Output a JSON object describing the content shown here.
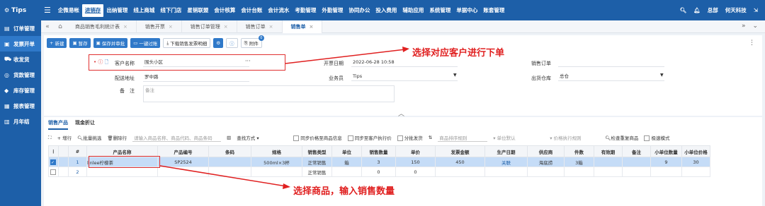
{
  "topbar": {
    "logo": "Tips",
    "nav": [
      "企微易帐",
      "进销存",
      "出纳管理",
      "线上商城",
      "线下门店",
      "星销联盟",
      "会计核算",
      "会计台账",
      "会计流水",
      "考勤管理",
      "外勤管理",
      "协同办公",
      "投入费用",
      "辅助应用",
      "系统管理",
      "单据中心",
      "账套管理"
    ],
    "active_nav": "进销存",
    "user": "总部",
    "company": "何天科技"
  },
  "sidebar": [
    {
      "label": "订单管理",
      "icon": "clipboard-icon"
    },
    {
      "label": "发票开单",
      "icon": "invoice-icon"
    },
    {
      "label": "收发货",
      "icon": "truck-icon"
    },
    {
      "label": "货款管理",
      "icon": "money-icon"
    },
    {
      "label": "库存管理",
      "icon": "warehouse-icon"
    },
    {
      "label": "报表管理",
      "icon": "report-icon"
    },
    {
      "label": "月年结",
      "icon": "calendar-icon"
    }
  ],
  "tabs": [
    "商品销售毛利统计表",
    "销售开票",
    "销售订单管理",
    "销售订单",
    "销售单"
  ],
  "toolbar": {
    "new": "新建",
    "save": "暂存",
    "save_audit": "保存并审批",
    "one_click": "一键过账",
    "download": "下载销售发票明细",
    "attachment": "附件",
    "attachment_count": "0"
  },
  "form": {
    "customer_label": "客户名称",
    "customer_value": "围头小区",
    "address_label": "配送地址",
    "address_value": "罗中路",
    "remark_label": "备　注",
    "remark_placeholder": "备注",
    "date_label": "开票日期",
    "date_value": "2022-06-28 10:58",
    "salesman_label": "业务员",
    "salesman_value": "Tips",
    "order_label": "销售订单",
    "order_value": "",
    "warehouse_label": "出货仓库",
    "warehouse_value": "总仓"
  },
  "grid": {
    "subtabs": [
      "销售产品",
      "现金折让"
    ],
    "tools": {
      "add_row": "增行",
      "batch_select": "批量挑选",
      "delete_row": "删除行",
      "search_placeholder": "请输入商品名称、商品代码、商品条码",
      "find_mode": "查找方式",
      "sync_price": "同步价格至商品信息",
      "sync_customer": "同步至客户执行价",
      "batch_ship": "分批发货",
      "sort_placeholder": "商品排序规则",
      "unit_default": "单位默认",
      "price_rule": "价格执行规则",
      "check_dup": "检查重复商品",
      "fast_mode": "极速模式"
    },
    "columns": [
      "#",
      "产品名称",
      "产品编号",
      "条码",
      "规格",
      "销售类型",
      "单位",
      "销售数量",
      "单价",
      "发票金额",
      "生产日期",
      "供应商",
      "件数",
      "有效期",
      "备注",
      "小单位数量",
      "小单位价格"
    ],
    "rows": [
      {
        "no": "1",
        "name": "linlee柠檬茶",
        "code": "SP2524",
        "barcode": "",
        "spec": "500ml×3杯",
        "type": "正常销售",
        "unit": "箱",
        "qty": "3",
        "price": "150",
        "amount": "450",
        "date": "关联",
        "supplier": "海底捞",
        "pieces": "3箱",
        "expiry": "",
        "remark": "",
        "small_qty": "9",
        "small_price": "30"
      },
      {
        "no": "2",
        "name": "",
        "code": "",
        "barcode": "",
        "spec": "",
        "type": "正常销售",
        "unit": "",
        "qty": "0",
        "price": "0",
        "amount": "",
        "date": "",
        "supplier": "",
        "pieces": "",
        "expiry": "",
        "remark": "",
        "small_qty": "",
        "small_price": ""
      }
    ]
  },
  "annotations": {
    "customer_tip": "选择对应客户进行下单",
    "product_tip": "选择商品，输入销售数量"
  }
}
